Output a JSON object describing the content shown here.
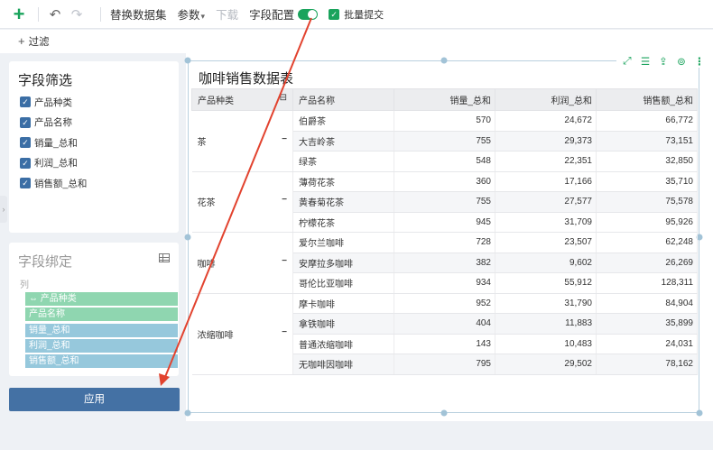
{
  "toolbar": {
    "add_icon": "plus-icon",
    "undo_icon": "undo-icon",
    "redo_icon": "redo-icon",
    "replace_dataset": "替换数据集",
    "params": "参数",
    "download": "下载",
    "field_config": "字段配置",
    "field_config_on": true,
    "batch_submit": "批量提交",
    "batch_submit_checked": true,
    "accent": "#1aa35c"
  },
  "filter_bar": {
    "label": "过滤"
  },
  "field_filter": {
    "title": "字段筛选",
    "items": [
      {
        "label": "产品种类",
        "checked": true
      },
      {
        "label": "产品名称",
        "checked": true
      },
      {
        "label": "销量_总和",
        "checked": true
      },
      {
        "label": "利润_总和",
        "checked": true
      },
      {
        "label": "销售额_总和",
        "checked": true
      }
    ]
  },
  "field_binding": {
    "title": "字段绑定",
    "column_label": "列",
    "chips": [
      {
        "label": "产品种类",
        "kind": "dimension",
        "color": "#8fd6b0"
      },
      {
        "label": "产品名称",
        "kind": "dimension",
        "color": "#8fd6b0"
      },
      {
        "label": "销量_总和",
        "kind": "measure",
        "color": "#96c8dc"
      },
      {
        "label": "利润_总和",
        "kind": "measure",
        "color": "#96c8dc"
      },
      {
        "label": "销售额_总和",
        "kind": "measure",
        "color": "#96c8dc"
      }
    ]
  },
  "apply_button": {
    "label": "应用",
    "color": "#4471a4"
  },
  "component_icons": [
    "fullscreen-icon",
    "list-icon",
    "export-icon",
    "link-icon",
    "more-icon"
  ],
  "table": {
    "title": "咖啡销售数据表",
    "headers": [
      "产品种类",
      "产品名称",
      "销量_总和",
      "利润_总和",
      "销售额_总和"
    ],
    "collapse_symbol": "−",
    "groups": [
      {
        "category": "茶",
        "rows": [
          [
            "伯爵茶",
            "570",
            "24,672",
            "66,772"
          ],
          [
            "大吉岭茶",
            "755",
            "29,373",
            "73,151"
          ],
          [
            "绿茶",
            "548",
            "22,351",
            "32,850"
          ]
        ]
      },
      {
        "category": "花茶",
        "rows": [
          [
            "薄荷花茶",
            "360",
            "17,166",
            "35,710"
          ],
          [
            "黄春菊花茶",
            "755",
            "27,577",
            "75,578"
          ],
          [
            "柠檬花茶",
            "945",
            "31,709",
            "95,926"
          ]
        ]
      },
      {
        "category": "咖啡",
        "rows": [
          [
            "爱尔兰咖啡",
            "728",
            "23,507",
            "62,248"
          ],
          [
            "安摩拉多咖啡",
            "382",
            "9,602",
            "26,269"
          ],
          [
            "哥伦比亚咖啡",
            "934",
            "55,912",
            "128,311"
          ]
        ]
      },
      {
        "category": "浓缩咖啡",
        "rows": [
          [
            "摩卡咖啡",
            "952",
            "31,790",
            "84,904"
          ],
          [
            "拿铁咖啡",
            "404",
            "11,883",
            "35,899"
          ],
          [
            "普通浓缩咖啡",
            "143",
            "10,483",
            "24,031"
          ],
          [
            "无咖啡因咖啡",
            "795",
            "29,502",
            "78,162"
          ]
        ]
      }
    ]
  },
  "annotation": {
    "type": "arrow",
    "color": "#e2432f"
  }
}
